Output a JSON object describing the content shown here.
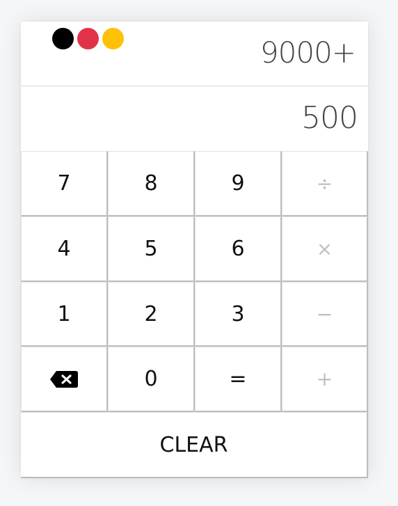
{
  "window": {
    "controls": [
      {
        "name": "close",
        "color": "#000000"
      },
      {
        "name": "minimize",
        "color": "#e0334a"
      },
      {
        "name": "maximize",
        "color": "#ffc107"
      }
    ]
  },
  "display": {
    "expression": "9000+",
    "current": "500"
  },
  "keys": {
    "k7": "7",
    "k8": "8",
    "k9": "9",
    "divide": "÷",
    "k4": "4",
    "k5": "5",
    "k6": "6",
    "multiply": "×",
    "k1": "1",
    "k2": "2",
    "k3": "3",
    "subtract": "−",
    "backspace_icon": "backspace-icon",
    "k0": "0",
    "equals": "=",
    "add": "+",
    "clear": "CLEAR"
  },
  "colors": {
    "background": "#f5f6f8",
    "panel": "#ffffff",
    "display_text": "#444444",
    "operator_text": "#bfbfbf",
    "key_border": "#bdbdbd"
  }
}
